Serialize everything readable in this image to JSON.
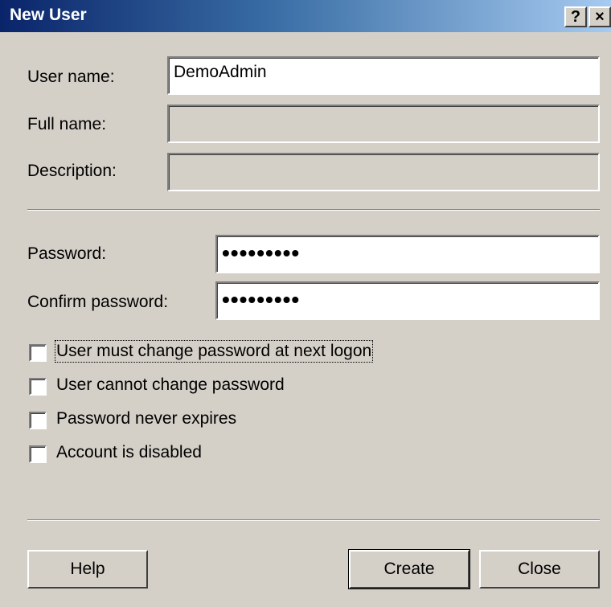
{
  "window": {
    "title": "New User",
    "help_caption": "?",
    "close_caption": "×"
  },
  "fields": {
    "user_name": {
      "label": "User name:",
      "value": "DemoAdmin"
    },
    "full_name": {
      "label": "Full name:",
      "value": ""
    },
    "description": {
      "label": "Description:",
      "value": ""
    },
    "password": {
      "label": "Password:",
      "value": "•••••••••"
    },
    "confirm_password": {
      "label": "Confirm password:",
      "value": "•••••••••"
    }
  },
  "options": [
    {
      "label": "User must change password at next logon",
      "checked": false
    },
    {
      "label": "User cannot change password",
      "checked": false
    },
    {
      "label": "Password never expires",
      "checked": false
    },
    {
      "label": "Account is disabled",
      "checked": false
    }
  ],
  "buttons": {
    "help": "Help",
    "create": "Create",
    "close": "Close"
  }
}
